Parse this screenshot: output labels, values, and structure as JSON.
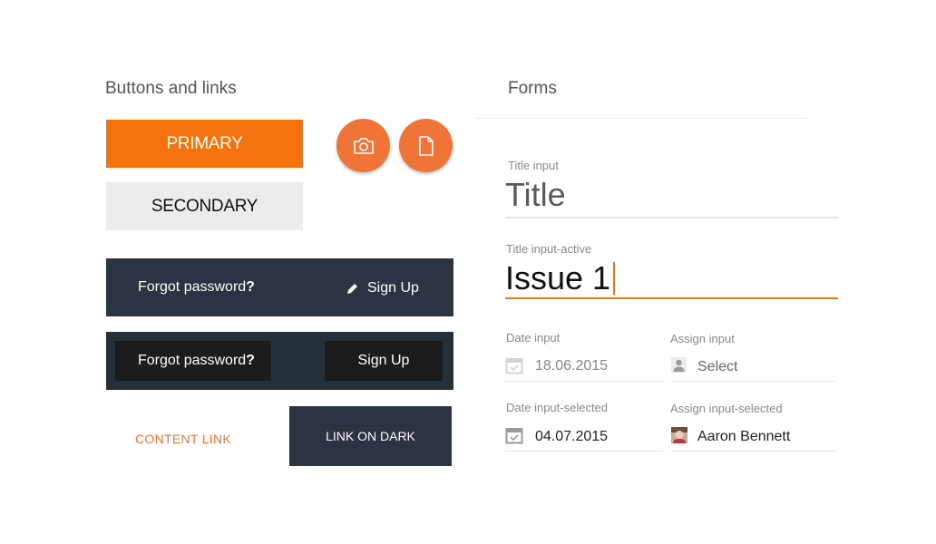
{
  "buttons_section": {
    "title": "Buttons and links",
    "primary_label": "PRIMARY",
    "secondary_label": "SECONDARY",
    "fab_camera_icon": "camera-icon",
    "fab_file_icon": "file-icon",
    "bar1": {
      "forgot": "Forgot password",
      "forgot_q": "?",
      "signup": "Sign Up",
      "signup_icon": "pencil-icon"
    },
    "bar2": {
      "forgot": "Forgot password",
      "forgot_q": "?",
      "signup": "Sign Up"
    },
    "content_link": "CONTENT LINK",
    "link_on_dark": "LINK ON DARK"
  },
  "forms_section": {
    "title": "Forms",
    "title_input": {
      "label": "Title input",
      "value": "Title"
    },
    "title_input_active": {
      "label": "Title input-active",
      "value": "Issue 1"
    },
    "date_input": {
      "label": "Date input",
      "value": "18.06.2015",
      "icon": "calendar-icon"
    },
    "assign_input": {
      "label": "Assign input",
      "value": "Select",
      "icon": "person-icon"
    },
    "date_input_selected": {
      "label": "Date input-selected",
      "value": "04.07.2015",
      "icon": "calendar-check-icon"
    },
    "assign_input_selected": {
      "label": "Assign input-selected",
      "value": "Aaron Bennett",
      "icon": "avatar"
    }
  },
  "colors": {
    "accent": "#f5730c",
    "fab": "#f07338",
    "dark": "#2b3440",
    "darker": "#1b1c1e",
    "light_gray": "#ececec"
  }
}
